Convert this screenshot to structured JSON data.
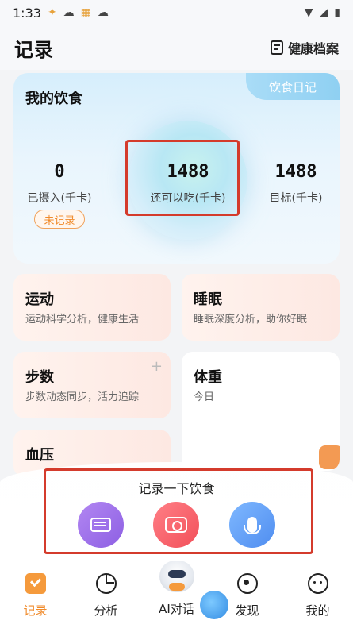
{
  "status_bar": {
    "time": "1:33"
  },
  "header": {
    "title": "记录",
    "action_label": "健康档案"
  },
  "diet_card": {
    "title": "我的饮食",
    "diary_tab": "饮食日记",
    "consumed": {
      "value": "0",
      "label": "已摄入(千卡)"
    },
    "remaining": {
      "value": "1488",
      "label": "还可以吃(千卡)"
    },
    "target": {
      "value": "1488",
      "label": "目标(千卡)"
    },
    "status_badge": "未记录"
  },
  "modules": {
    "exercise": {
      "title": "运动",
      "desc": "运动科学分析，健康生活"
    },
    "sleep": {
      "title": "睡眠",
      "desc": "睡眠深度分析，助你好眠"
    },
    "steps": {
      "title": "步数",
      "desc": "步数动态同步，活力追踪"
    },
    "weight": {
      "title": "体重",
      "desc": "今日"
    },
    "blood_pressure": {
      "title": "血压"
    }
  },
  "record_sheet": {
    "title": "记录一下饮食"
  },
  "tabs": [
    {
      "label": "记录"
    },
    {
      "label": "分析"
    },
    {
      "label": "AI对话"
    },
    {
      "label": "发现"
    },
    {
      "label": "我的"
    }
  ],
  "colors": {
    "accent": "#f08a2a",
    "highlight": "#d43b2c"
  }
}
